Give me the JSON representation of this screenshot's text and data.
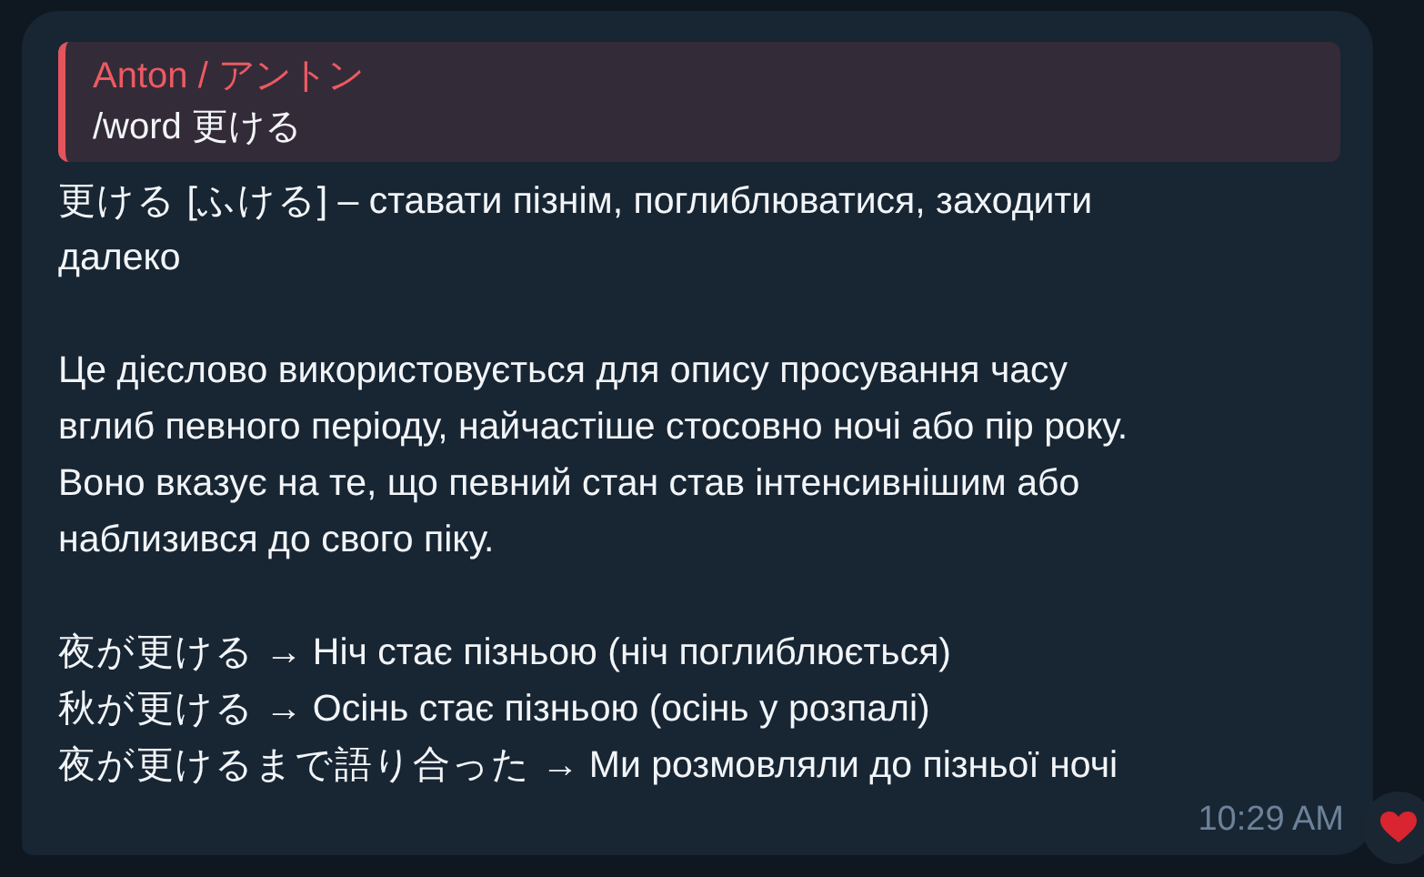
{
  "message": {
    "reply": {
      "author": "Anton / アントン",
      "text": "/word 更ける"
    },
    "paragraphs": [
      {
        "lines": [
          "更ける [ふける] – ставати пізнім, поглиблюватися, заходити",
          "далеко"
        ]
      },
      {
        "lines": [
          "Це дієслово використовується для опису просування часу",
          "вглиб певного періоду, найчастіше стосовно ночі або пір року.",
          "Воно вказує на те, що певний стан став інтенсивнішим або",
          "наблизився до свого піку."
        ]
      },
      {
        "lines": [
          "夜が更ける → Ніч стає пізньою (ніч поглиблюється)",
          "秋が更ける → Осінь стає пізньою (осінь у розпалі)",
          "夜が更けるまで語り合った → Ми розмовляли до пізньої ночі"
        ]
      }
    ],
    "time": "10:29 AM",
    "reaction": {
      "kind": "heart"
    }
  }
}
